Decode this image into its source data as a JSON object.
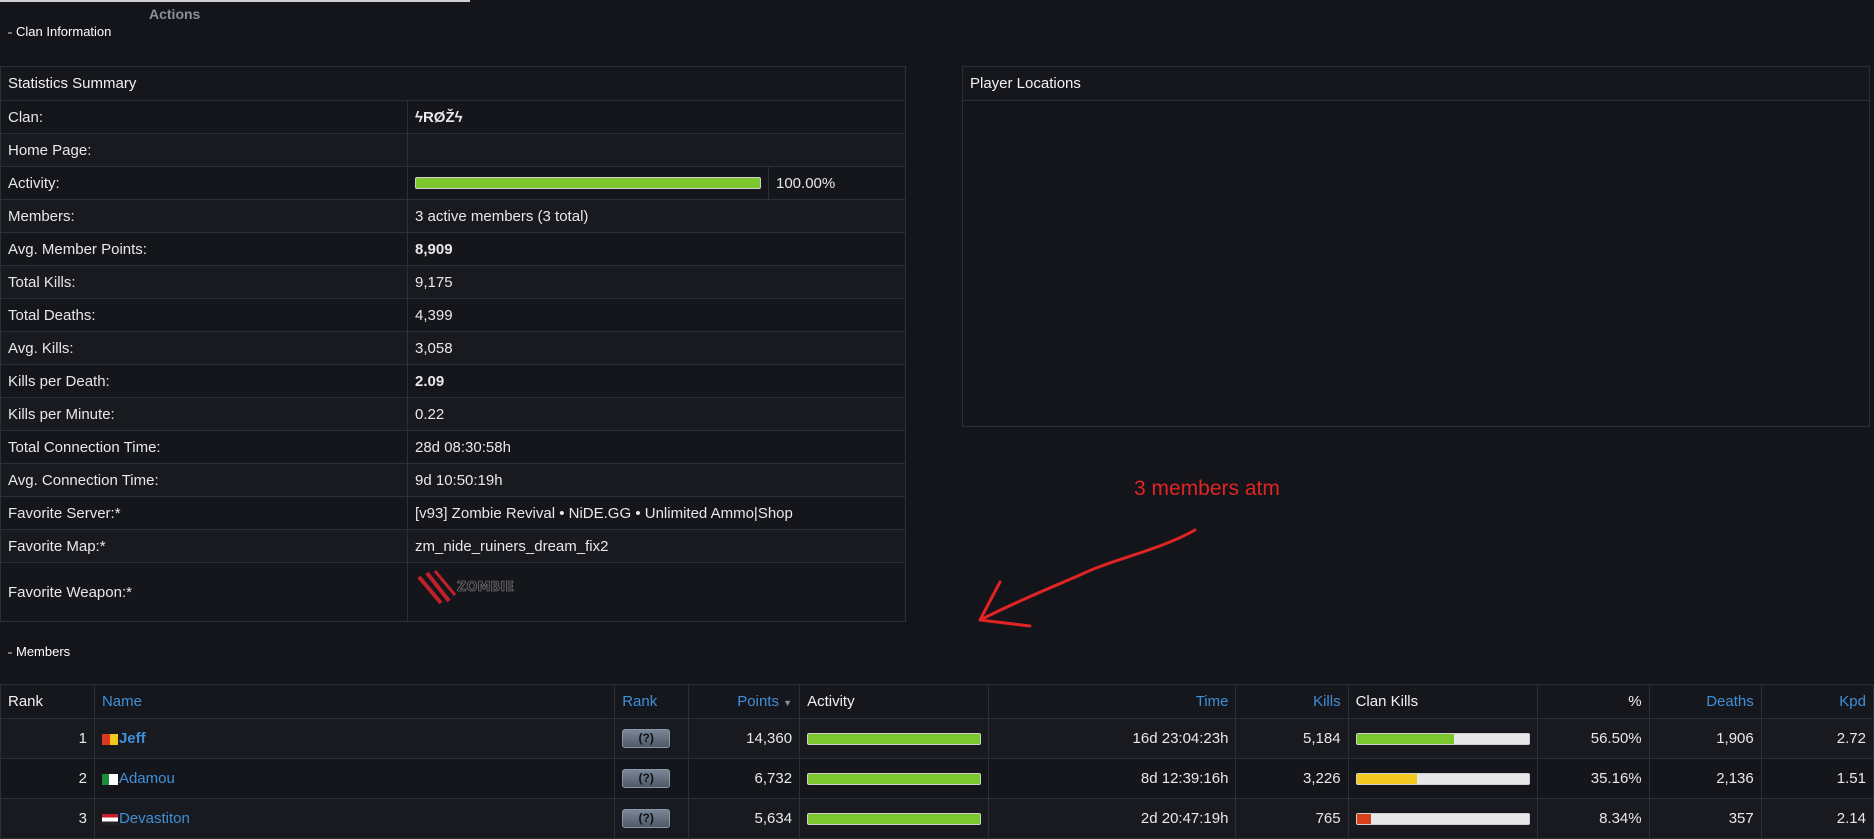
{
  "header": {
    "actions_label": "Actions"
  },
  "clan_info": {
    "section_title": "Clan Information",
    "stats_title": "Statistics Summary",
    "rows": [
      {
        "label": "Clan:",
        "value": "ϟRØŽϟ"
      },
      {
        "label": "Home Page:",
        "value": ""
      },
      {
        "label": "Activity:",
        "value": "100.00%",
        "activity_fraction": 1.0
      },
      {
        "label": "Members:",
        "value": "3 active members (3 total)"
      },
      {
        "label": "Avg. Member Points:",
        "value": "8,909"
      },
      {
        "label": "Total Kills:",
        "value": "9,175"
      },
      {
        "label": "Total Deaths:",
        "value": "4,399"
      },
      {
        "label": "Avg. Kills:",
        "value": "3,058"
      },
      {
        "label": "Kills per Death:",
        "value": "2.09"
      },
      {
        "label": "Kills per Minute:",
        "value": "0.22"
      },
      {
        "label": "Total Connection Time:",
        "value": "28d 08:30:58h"
      },
      {
        "label": "Avg. Connection Time:",
        "value": "9d 10:50:19h"
      },
      {
        "label": "Favorite Server:*",
        "value": "[v93] Zombie Revival • NiDE.GG • Unlimited Ammo|Shop"
      },
      {
        "label": "Favorite Map:*",
        "value": "zm_nide_ruiners_dream_fix2"
      },
      {
        "label": "Favorite Weapon:*",
        "value": "ZOMBIE"
      }
    ],
    "locations_title": "Player Locations"
  },
  "annotation": {
    "text": "3 members atm",
    "color": "#e02424"
  },
  "members": {
    "section_title": "Members",
    "columns": [
      "Rank",
      "Name",
      "Rank",
      "Points",
      "Activity",
      "Time",
      "Kills",
      "Clan Kills",
      "%",
      "Deaths",
      "Kpd"
    ],
    "rows": [
      {
        "rank": "1",
        "name": "Jeff",
        "badge": "(?)",
        "points": "14,360",
        "activity_fraction": 1.0,
        "time": "16d 23:04:23h",
        "kills": "5,184",
        "clan_kills_fraction": 0.565,
        "clan_kills_color": "#7dc72e",
        "pct": "56.50%",
        "deaths": "1,906",
        "kpd": "2.72"
      },
      {
        "rank": "2",
        "name": "Adamou",
        "badge": "(?)",
        "points": "6,732",
        "activity_fraction": 1.0,
        "time": "8d 12:39:16h",
        "kills": "3,226",
        "clan_kills_fraction": 0.3516,
        "clan_kills_color": "#f2c81e",
        "pct": "35.16%",
        "deaths": "2,136",
        "kpd": "1.51"
      },
      {
        "rank": "3",
        "name": "Devastiton",
        "badge": "(?)",
        "points": "5,634",
        "activity_fraction": 1.0,
        "time": "2d 20:47:19h",
        "kills": "765",
        "clan_kills_fraction": 0.0834,
        "clan_kills_color": "#d8401a",
        "pct": "8.34%",
        "deaths": "357",
        "kpd": "2.14"
      }
    ]
  },
  "colors": {
    "link": "#3f8fd8",
    "activity_bar": "#7dc72e",
    "background": "#13151a",
    "border": "#2b2f37"
  }
}
